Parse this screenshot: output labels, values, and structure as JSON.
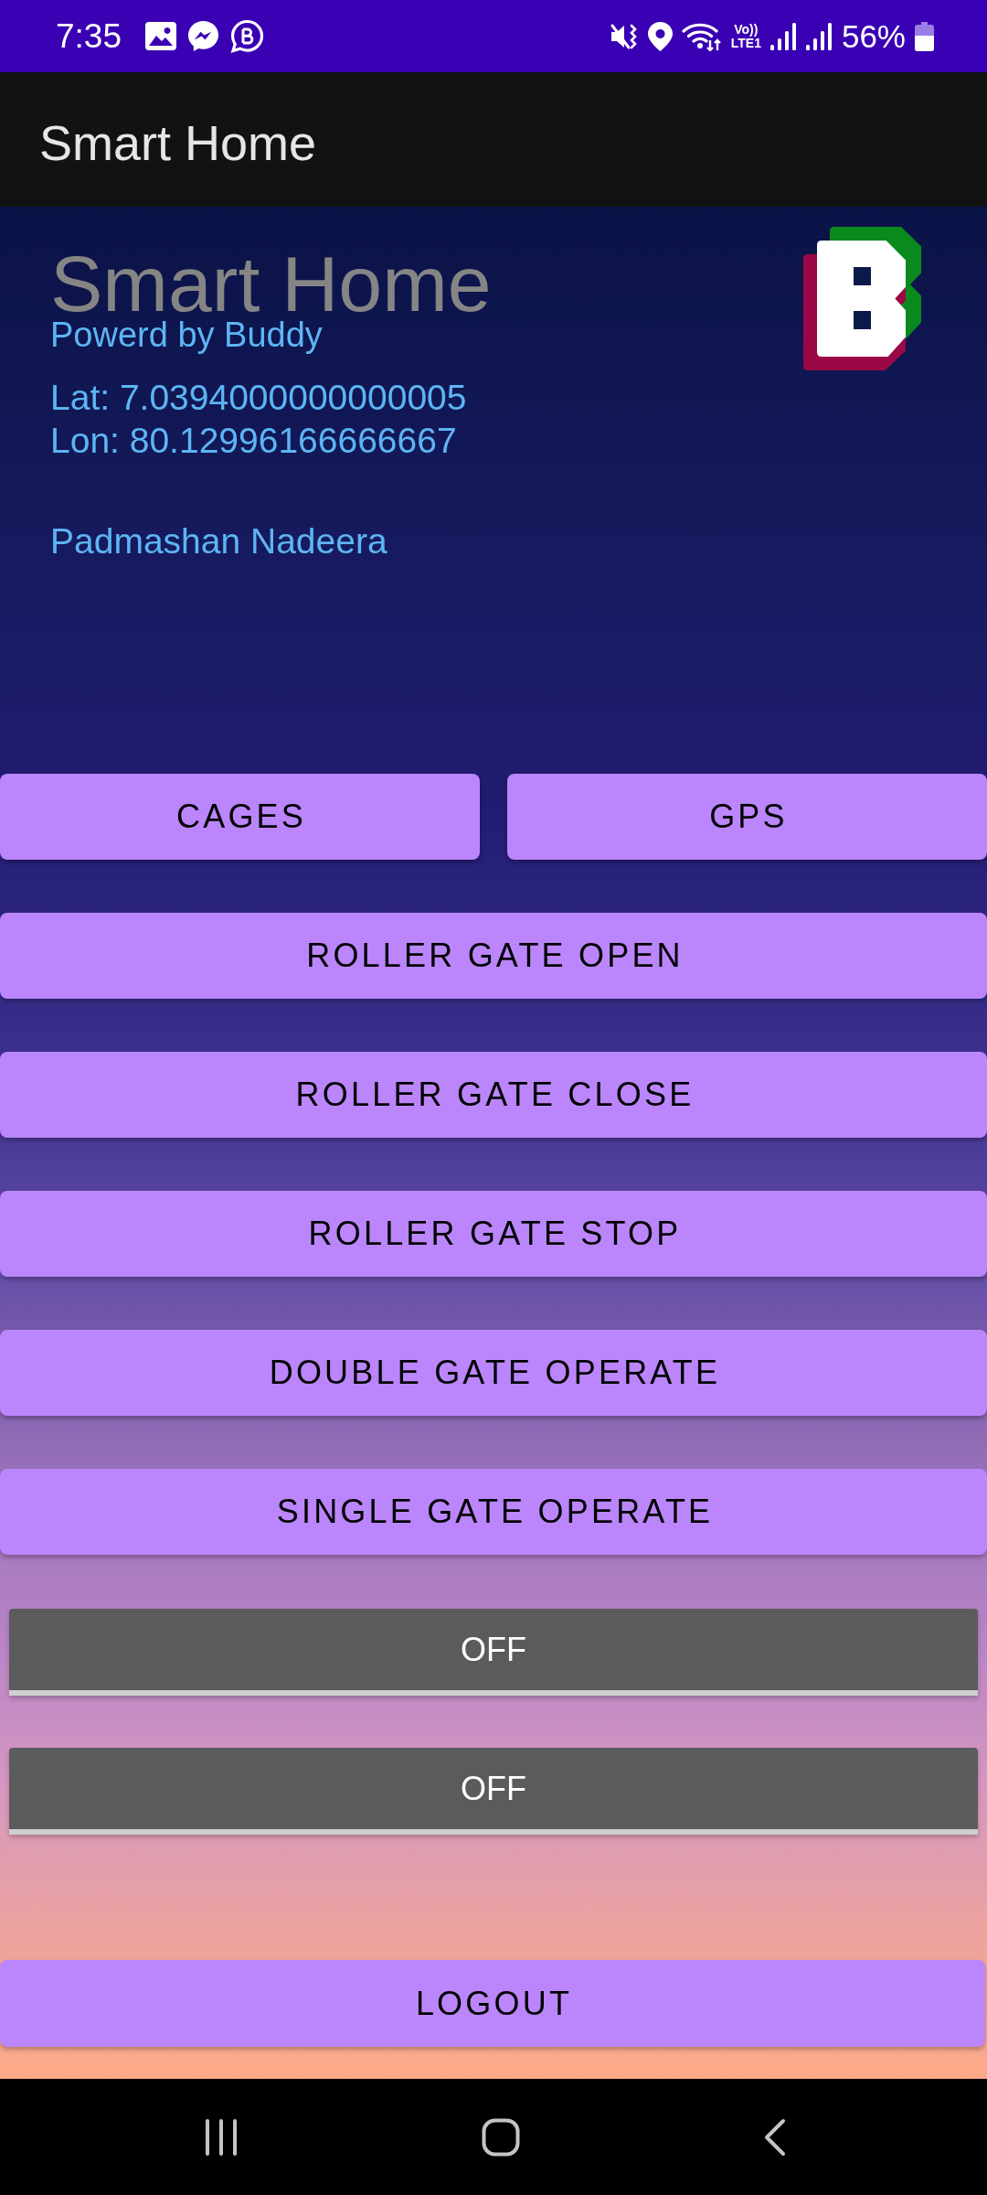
{
  "status_bar": {
    "time": "7:35",
    "network_type": [
      "Vo))",
      "LTE1"
    ],
    "battery": "56%"
  },
  "app_bar": {
    "title": "Smart Home"
  },
  "header": {
    "title": "Smart Home",
    "subtitle": "Powerd by Buddy",
    "latitude": "Lat: 7.0394000000000005",
    "longitude": "Lon: 80.12996166666667",
    "user_name": "Padmashan Nadeera"
  },
  "button_rows": [
    {
      "buttons": [
        "CAGES",
        "GPS"
      ]
    },
    {
      "buttons": [
        "ROLLER GATE OPEN"
      ]
    },
    {
      "buttons": [
        "ROLLER GATE CLOSE"
      ]
    },
    {
      "buttons": [
        "ROLLER GATE STOP"
      ]
    },
    {
      "buttons": [
        "DOUBLE GATE OPERATE"
      ]
    },
    {
      "buttons": [
        "SINGLE GATE OPERATE"
      ]
    }
  ],
  "toggles": [
    {
      "label": "OFF",
      "on": false
    },
    {
      "label": "OFF",
      "on": false
    }
  ],
  "logout_button": {
    "label": "LOGOUT"
  }
}
